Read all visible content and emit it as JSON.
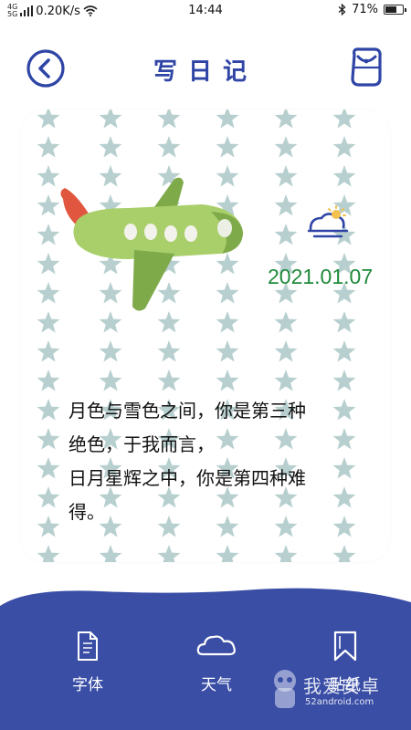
{
  "status_bar": {
    "signal_1": "4G",
    "signal_2": "5G",
    "net_speed": "0.20K/s",
    "time": "14:44",
    "battery_percent": "71%",
    "battery_level": 0.71
  },
  "header": {
    "title": "写日记"
  },
  "diary": {
    "date": "2021.01.07",
    "weather": "partly-cloudy-sun-icon",
    "lines": [
      "月色与雪色之间，你是第三种",
      "绝色，于我而言，",
      "日月星辉之中，你是第四种难",
      "得。"
    ]
  },
  "toolbar": {
    "font_label": "字体",
    "weather_label": "天气",
    "sticker_label": "贴纸"
  },
  "watermark": {
    "title": "我爱安卓",
    "url": "52android.com"
  },
  "colors": {
    "primary": "#2f45a6",
    "date_green": "#1f8a3a",
    "star": "#b8cfcf",
    "bottom_bar": "#3a4ea6"
  }
}
